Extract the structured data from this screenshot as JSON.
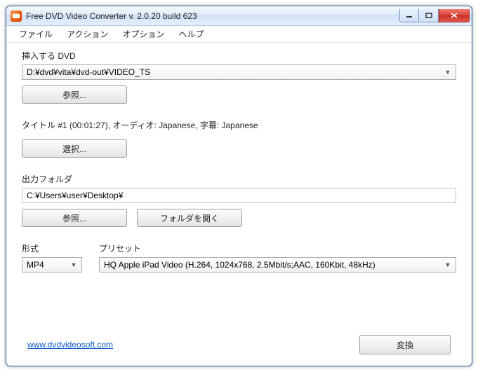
{
  "title": "Free DVD Video Converter  v. 2.0.20 build 623",
  "menu": {
    "file": "ファイル",
    "action": "アクション",
    "options": "オプション",
    "help": "ヘルプ"
  },
  "insert_dvd": {
    "label": "挿入する DVD",
    "value": "D:¥dvd¥vita¥dvd-out¥VIDEO_TS",
    "browse": "参照..."
  },
  "title_info": "タイトル #1 (00:01:27), オーディオ: Japanese, 字幕: Japanese",
  "select_btn": "選択...",
  "output": {
    "label": "出力フォルダ",
    "value": "C:¥Users¥user¥Desktop¥",
    "browse": "参照...",
    "open_folder": "フォルダを開く"
  },
  "format": {
    "label": "形式",
    "value": "MP4"
  },
  "preset": {
    "label": "プリセット",
    "value": "HQ Apple iPad Video (H.264, 1024x768, 2.5Mbit/s;AAC, 160Kbit, 48kHz)"
  },
  "footer": {
    "link": "www.dvdvideosoft.com",
    "convert": "変換"
  }
}
